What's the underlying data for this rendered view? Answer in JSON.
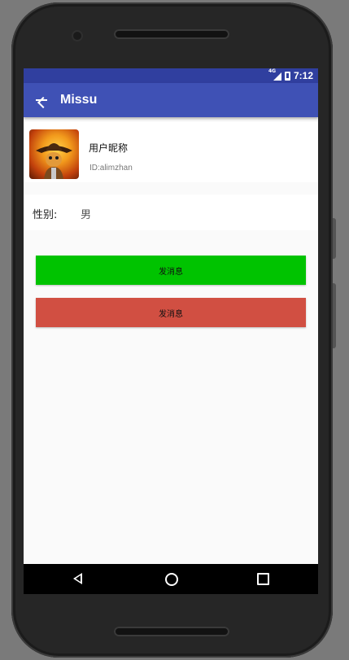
{
  "status_bar": {
    "network": "4G",
    "time": "7:12"
  },
  "app_bar": {
    "back_icon": "arrow-left-icon",
    "title": "Missu"
  },
  "profile": {
    "avatar_icon": "avatar-image",
    "nickname": "用户昵称",
    "user_id": "ID:alimzhan"
  },
  "gender": {
    "label": "性别:",
    "value": "男"
  },
  "buttons": {
    "primary_label": "发消息",
    "primary_color": "#00c300",
    "secondary_label": "发消息",
    "secondary_color": "#d14f42"
  },
  "theme": {
    "primary": "#3f51b5",
    "primary_dark": "#303f9f"
  },
  "nav_bar": {
    "back_icon": "triangle-back-icon",
    "home_icon": "circle-home-icon",
    "recents_icon": "square-recents-icon"
  }
}
